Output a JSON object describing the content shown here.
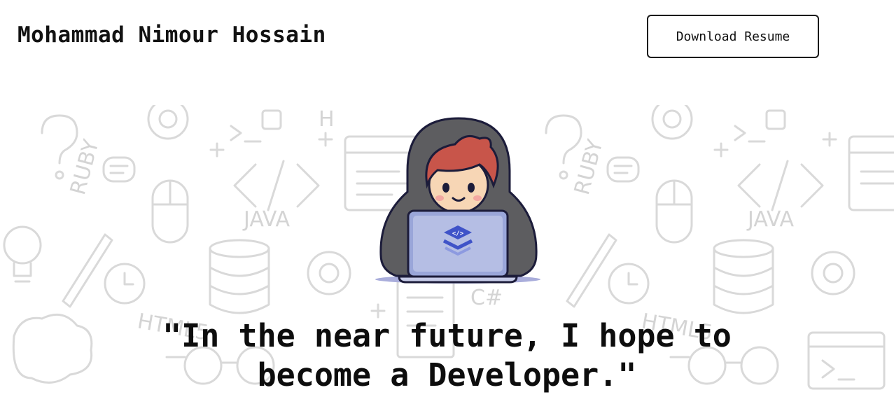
{
  "header": {
    "title": "Mohammad Nimour Hossain",
    "resume_button_label": "Download Resume"
  },
  "hero": {
    "background_labels": [
      "JAVA",
      "RUBY",
      "HTML5",
      "C#",
      "JAVA",
      "RUBY",
      "HTML5",
      "H"
    ],
    "laptop_code_glyph": "</>",
    "quote_line_1": "\"In the near future, I hope to",
    "quote_line_2": "become a Developer.\""
  },
  "colors": {
    "doodle": "#d9d9d9",
    "hood": "#5b5b5b",
    "hair": "#c8554a",
    "laptop": "#9aa6d9",
    "logo": "#3f53c8"
  }
}
